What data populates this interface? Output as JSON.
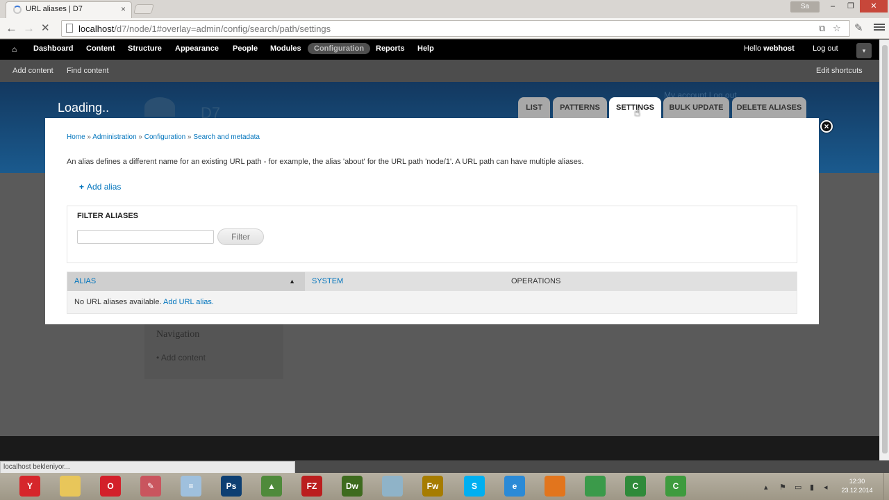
{
  "browser": {
    "tab_title": "URL aliases | D7",
    "tab_close": "×",
    "user_badge": "Sa",
    "win_min": "–",
    "win_max": "❐",
    "win_close": "✕",
    "back": "←",
    "forward": "→",
    "stop": "✕",
    "url_host": "localhost",
    "url_path": "/d7/node/1#overlay=admin/config/search/path/settings",
    "status_text": "localhost bekleniyor..."
  },
  "admin_toolbar": {
    "home_icon": "home-icon",
    "items": [
      "Dashboard",
      "Content",
      "Structure",
      "Appearance",
      "People",
      "Modules",
      "Configuration",
      "Reports",
      "Help"
    ],
    "active_item": "Configuration",
    "hello_prefix": "Hello ",
    "username": "webhost",
    "logout": "Log out",
    "shortcuts": [
      "Add content",
      "Find content"
    ],
    "edit_shortcuts": "Edit shortcuts"
  },
  "page": {
    "loading": "Loading..",
    "site_name": "D7",
    "secondary_menu": "My account   Log out",
    "nav_block_title": "Navigation",
    "nav_block_link": "• Add content"
  },
  "overlay": {
    "tabs": [
      "LIST",
      "PATTERNS",
      "SETTINGS",
      "BULK UPDATE",
      "DELETE ALIASES"
    ],
    "active_tab": "SETTINGS",
    "close_symbol": "×",
    "breadcrumb": [
      "Home",
      "Administration",
      "Configuration",
      "Search and metadata"
    ],
    "breadcrumb_sep": "»",
    "help_text": "An alias defines a different name for an existing URL path - for example, the alias 'about' for the URL path 'node/1'. A URL path can have multiple aliases.",
    "add_alias_plus": "+",
    "add_alias": "Add alias",
    "filter_legend": "FILTER ALIASES",
    "filter_value": "",
    "filter_button": "Filter",
    "table_headers": [
      "ALIAS",
      "SYSTEM",
      "OPERATIONS"
    ],
    "sort_indicator": "▲",
    "empty_text": "No URL aliases available.",
    "empty_link": "Add URL alias."
  },
  "taskbar": {
    "apps": [
      {
        "icon": "yandex-icon",
        "glyph": "Y",
        "color": "#d6262b"
      },
      {
        "icon": "folder-icon",
        "glyph": "",
        "color": "#e8c65a"
      },
      {
        "icon": "opera-icon",
        "glyph": "O",
        "color": "#d3202a"
      },
      {
        "icon": "paint-icon",
        "glyph": "✎",
        "color": "#c9555e"
      },
      {
        "icon": "notepad-icon",
        "glyph": "≡",
        "color": "#9fc0dd"
      },
      {
        "icon": "photoshop-icon",
        "glyph": "Ps",
        "color": "#0d3f72"
      },
      {
        "icon": "image-viewer-icon",
        "glyph": "▲",
        "color": "#4f8a3b"
      },
      {
        "icon": "filezilla-icon",
        "glyph": "FZ",
        "color": "#bb1e1e"
      },
      {
        "icon": "dreamweaver-icon",
        "glyph": "Dw",
        "color": "#3e6b1e"
      },
      {
        "icon": "package-icon",
        "glyph": "",
        "color": "#8fb3c8"
      },
      {
        "icon": "fireworks-icon",
        "glyph": "Fw",
        "color": "#a67c00"
      },
      {
        "icon": "skype-icon",
        "glyph": "S",
        "color": "#00aff0"
      },
      {
        "icon": "ie-icon",
        "glyph": "e",
        "color": "#2b8ad6"
      },
      {
        "icon": "firefox-icon",
        "glyph": "",
        "color": "#e2751d"
      },
      {
        "icon": "chrome-icon",
        "glyph": "",
        "color": "#3b9a4a"
      },
      {
        "icon": "camtasia-icon",
        "glyph": "C",
        "color": "#2f8a3a"
      },
      {
        "icon": "camtasia-recorder-icon",
        "glyph": "C",
        "color": "#3e9b3e"
      }
    ],
    "tray_arrow": "▴",
    "time": "12:30",
    "date": "23.12.2014"
  }
}
